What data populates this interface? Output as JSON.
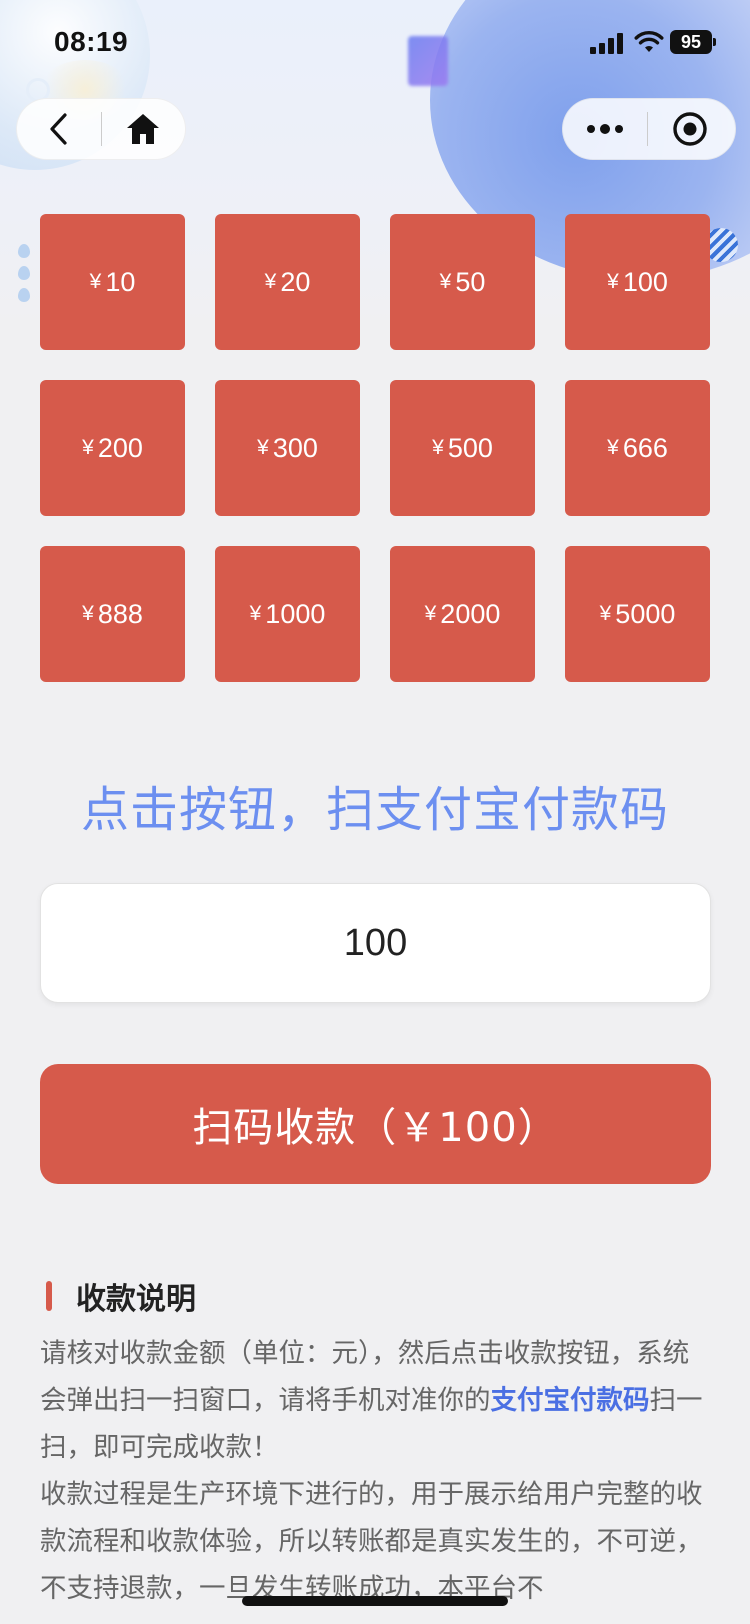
{
  "status_bar": {
    "time": "08:19",
    "battery": "95",
    "icons": [
      "signal-icon",
      "wifi-icon",
      "battery-icon"
    ]
  },
  "nav": {
    "left_icons": [
      "back-chevron-icon",
      "home-icon"
    ],
    "right_icons": [
      "more-dots-icon",
      "record-target-icon"
    ]
  },
  "currency_symbol": "¥",
  "amounts": [
    "10",
    "20",
    "50",
    "100",
    "200",
    "300",
    "500",
    "666",
    "888",
    "1000",
    "2000",
    "5000"
  ],
  "hint_text": "点击按钮，扫支付宝付款码",
  "amount_input": {
    "value": "100"
  },
  "collect_button": {
    "label": "扫码收款（￥100）"
  },
  "instructions": {
    "title": "收款说明",
    "p1_part1": "请核对收款金额（单位：元），然后点击收款按钮，系统会弹出扫一扫窗口，请将手机对准你的",
    "p1_highlight": "支付宝付款码",
    "p1_part2": "扫一扫，即可完成收款！",
    "p2": "收款过程是生产环境下进行的，用于展示给用户完整的收款流程和收款体验，所以转账都是真实发生的，不可逆，不支持退款，一旦发生转账成功，本平台不"
  },
  "colors": {
    "accent_red": "#d65a4b",
    "hint_blue": "#6c8ff0",
    "highlight_blue": "#4a6fe3",
    "background": "#f0f0f2"
  }
}
